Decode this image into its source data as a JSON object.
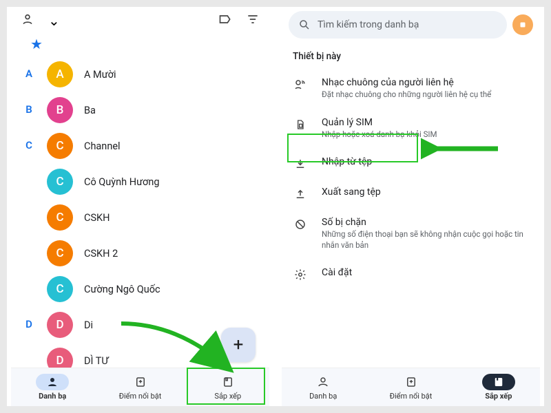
{
  "left": {
    "star": "★",
    "sections": [
      {
        "letter": "A",
        "contacts": [
          {
            "initial": "A",
            "name": "A Mười",
            "color": "#f5b400"
          }
        ]
      },
      {
        "letter": "B",
        "contacts": [
          {
            "initial": "B",
            "name": "Ba",
            "color": "#e2418e"
          }
        ]
      },
      {
        "letter": "C",
        "contacts": [
          {
            "initial": "C",
            "name": "Channel",
            "color": "#f57c00"
          },
          {
            "initial": "C",
            "name": "Cô Quỳnh Hương",
            "color": "#26c0d3"
          },
          {
            "initial": "C",
            "name": "CSKH",
            "color": "#f57c00"
          },
          {
            "initial": "C",
            "name": "CSKH 2",
            "color": "#f57c00"
          },
          {
            "initial": "C",
            "name": "Cường Ngô Quốc",
            "color": "#26c0d3"
          }
        ]
      },
      {
        "letter": "D",
        "contacts": [
          {
            "initial": "D",
            "name": "Di",
            "color": "#e85c7b"
          },
          {
            "initial": "D",
            "name": "DÌ TƯ",
            "color": "#e85c7b"
          }
        ]
      }
    ],
    "fab": "+",
    "nav": {
      "contacts": "Danh bạ",
      "highlights": "Điểm nổi bật",
      "organize": "Sắp xếp"
    }
  },
  "right": {
    "search_placeholder": "Tìm kiếm trong danh bạ",
    "section_title": "Thiết bị này",
    "rows": {
      "ringtone_title": "Nhạc chuông của người liên hệ",
      "ringtone_sub": "Đặt nhạc chuông cho những người liên hệ cụ thể",
      "sim_title": "Quản lý SIM",
      "sim_sub": "Nhập hoặc xoá danh bạ khỏi SIM",
      "import_title": "Nhập từ tệp",
      "export_title": "Xuất sang tệp",
      "blocked_title": "Số bị chặn",
      "blocked_sub": "Những số điện thoại bạn sẽ không nhận cuộc gọi hoặc tin nhắn văn bản",
      "settings_title": "Cài đặt"
    },
    "nav": {
      "contacts": "Danh bạ",
      "highlights": "Điểm nổi bật",
      "organize": "Sắp xếp"
    }
  }
}
